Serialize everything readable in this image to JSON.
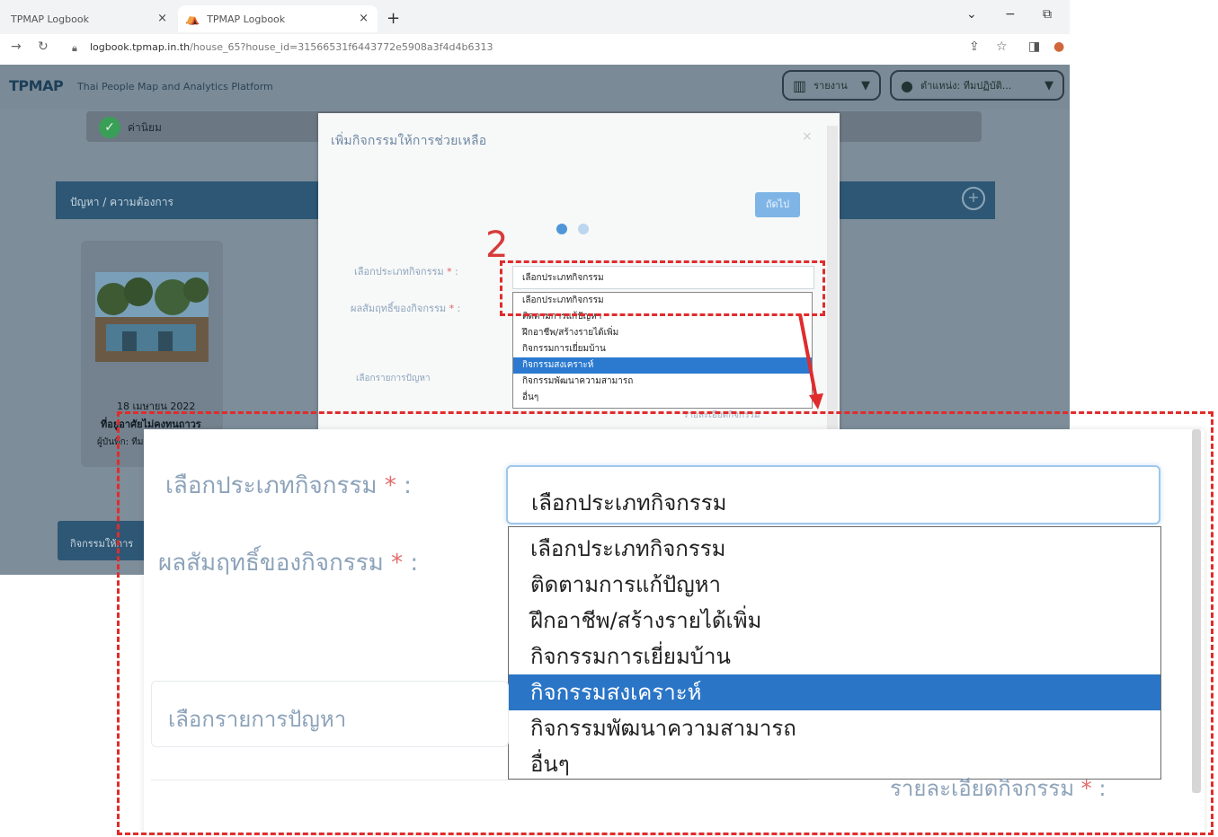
{
  "browser": {
    "tabs": [
      {
        "title": "TPMAP Logbook"
      },
      {
        "title": "TPMAP Logbook"
      }
    ],
    "new_tab": "+",
    "url_host": "logbook.tpmap.in.th",
    "url_path": "/house_65?house_id=31566531f6443772e5908a3f4d4b6313"
  },
  "app": {
    "brand": "TPMAP",
    "tagline": "Thai People Map and Analytics Platform",
    "nav_menu": "รายงาน",
    "nav_user": "ตำแหน่ง: ทีมปฏิบัติ..."
  },
  "page": {
    "status_label": "ค่านิยม",
    "problem_header": "ปัญหา / ความต้องการ",
    "card_date": "18 เมษายน 2022",
    "card_title": "ที่อยู่อาศัยไม่คงทนถาวร",
    "card_by": "ผู้บันทึก: ทีม",
    "activity_button": "กิจกรรมให้การ"
  },
  "modal": {
    "title": "เพิ่มกิจกรรมให้การช่วยเหลือ",
    "close": "×",
    "next_button": "ถัดไป",
    "label_type": "เลือกประเภทกิจกรรม",
    "label_result": "ผลสัมฤทธิ์ของกิจกรรม",
    "required_mark": "*",
    "colon": ":",
    "label_problem": "เลือกรายการปัญหา",
    "select_value": "เลือกประเภทกิจกรรม",
    "options": [
      "เลือกประเภทกิจกรรม",
      "ติดตามการแก้ปัญหา",
      "ฝึกอาชีพ/สร้างรายได้เพิ่ม",
      "กิจกรรมการเยี่ยมบ้าน",
      "กิจกรรมสงเคราะห์",
      "กิจกรรมพัฒนาความสามารถ",
      "อื่นๆ"
    ],
    "selected_index": 4,
    "detail_label": "รายละเอียดกิจกรรม"
  },
  "annotation": {
    "step_number": "2",
    "color": "#e02c2c"
  }
}
